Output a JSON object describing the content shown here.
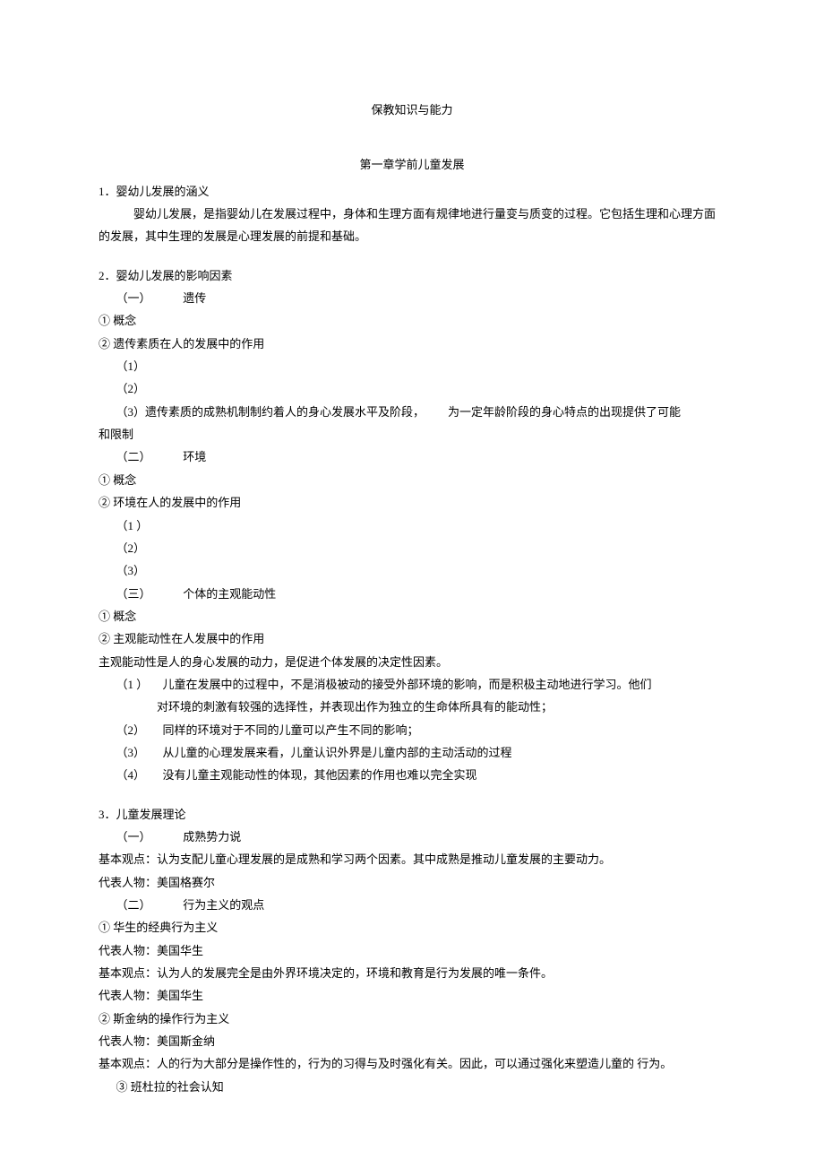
{
  "title": "保教知识与能力",
  "chapter": "第一章学前儿童发展",
  "s1": {
    "heading": "1．婴幼儿发展的涵义",
    "body": "婴幼儿发展，是指婴幼儿在发展过程中，身体和生理方面有规律地进行量变与质变的过程。它包括生理和心理方面的发展，其中生理的发展是心理发展的前提和基础。"
  },
  "s2": {
    "heading": "2．婴幼儿发展的影响因素",
    "i": {
      "label": "（一）",
      "name": "遗传"
    },
    "i_1": "①  概念",
    "i_2": "②  遗传素质在人的发展中的作用",
    "i_2_1": "（1）",
    "i_2_2": "（2）",
    "i_2_3a": "（3）遗传素质的成熟机制制约着人的身心发展水平及阶段，",
    "i_2_3b": "为一定年龄阶段的身心特点的出现提供了可能",
    "i_2_3c": "和限制",
    "ii": {
      "label": "（二）",
      "name": "环境"
    },
    "ii_1": "①  概念",
    "ii_2": "②  环境在人的发展中的作用",
    "ii_2_1": "（1 ）",
    "ii_2_2": "（2）",
    "ii_2_3": "（3）",
    "iii": {
      "label": "（三）",
      "name": "个体的主观能动性"
    },
    "iii_1": "①  概念",
    "iii_2": "②  主观能动性在人发展中的作用",
    "iii_body": "主观能动性是人的身心发展的动力，是促进个体发展的决定性因素。",
    "iii_b1_label": "（1 ）",
    "iii_b1a": "儿童在发展中的过程中，不是消极被动的接受外部环境的影响，而是积极主动地进行学习。他们",
    "iii_b1b": "对环境的刺激有较强的选择性，并表现出作为独立的生命体所具有的能动性；",
    "iii_b2_label": "（2）",
    "iii_b2": "同样的环境对于不同的儿童可以产生不同的影响；",
    "iii_b3_label": "（3）",
    "iii_b3": "从儿童的心理发展来看，儿童认识外界是儿童内部的主动活动的过程",
    "iii_b4_label": "（4）",
    "iii_b4": "没有儿童主观能动性的体现，其他因素的作用也难以完全实现"
  },
  "s3": {
    "heading": "3．儿童发展理论",
    "i": {
      "label": "（一）",
      "name": "成熟势力说"
    },
    "i_body1": "基本观点：认为支配儿童心理发展的是成熟和学习两个因素。其中成熟是推动儿童发展的主要动力。",
    "i_body2": "代表人物：美国格赛尔",
    "ii": {
      "label": "（二）",
      "name": "行为主义的观点"
    },
    "ii_a1": "①  华生的经典行为主义",
    "ii_a2": "代表人物：美国华生",
    "ii_a3": "基本观点：认为人的发展完全是由外界环境决定的，环境和教育是行为发展的唯一条件。",
    "ii_a4": "代表人物：美国华生",
    "ii_b1": "②  斯金纳的操作行为主义",
    "ii_b2": "代表人物：美国斯金纳",
    "ii_b3": "基本观点：人的行为大部分是操作性的，行为的习得与及时强化有关。因此，可以通过强化来塑造儿童的  行为。",
    "ii_c1": "③  班杜拉的社会认知"
  }
}
